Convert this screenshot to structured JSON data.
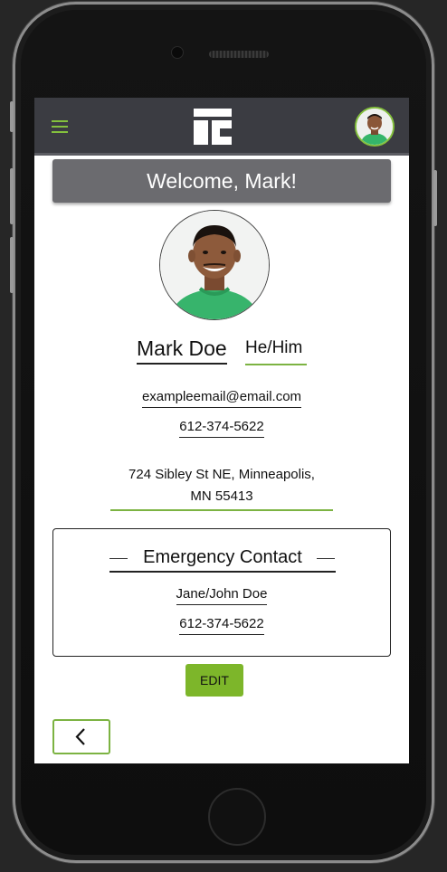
{
  "header": {
    "menu_icon": "hamburger-menu-icon",
    "logo_icon": "app-logo-icon",
    "avatar_icon": "user-avatar-icon"
  },
  "welcome_text": "Welcome, Mark!",
  "profile": {
    "name": "Mark Doe",
    "pronouns": "He/Him",
    "email": "exampleemail@email.com",
    "phone": "612-374-5622",
    "address_line1": "724 Sibley St NE, Minneapolis,",
    "address_line2": "MN 55413"
  },
  "emergency_contact": {
    "title": "Emergency Contact",
    "name": "Jane/John Doe",
    "phone": "612-374-5622"
  },
  "buttons": {
    "edit_label": "EDIT",
    "back_icon": "chevron-left-icon"
  },
  "colors": {
    "accent": "#7db62a",
    "header_bg": "#3b3c42",
    "welcome_bg": "#6b6b6f"
  }
}
